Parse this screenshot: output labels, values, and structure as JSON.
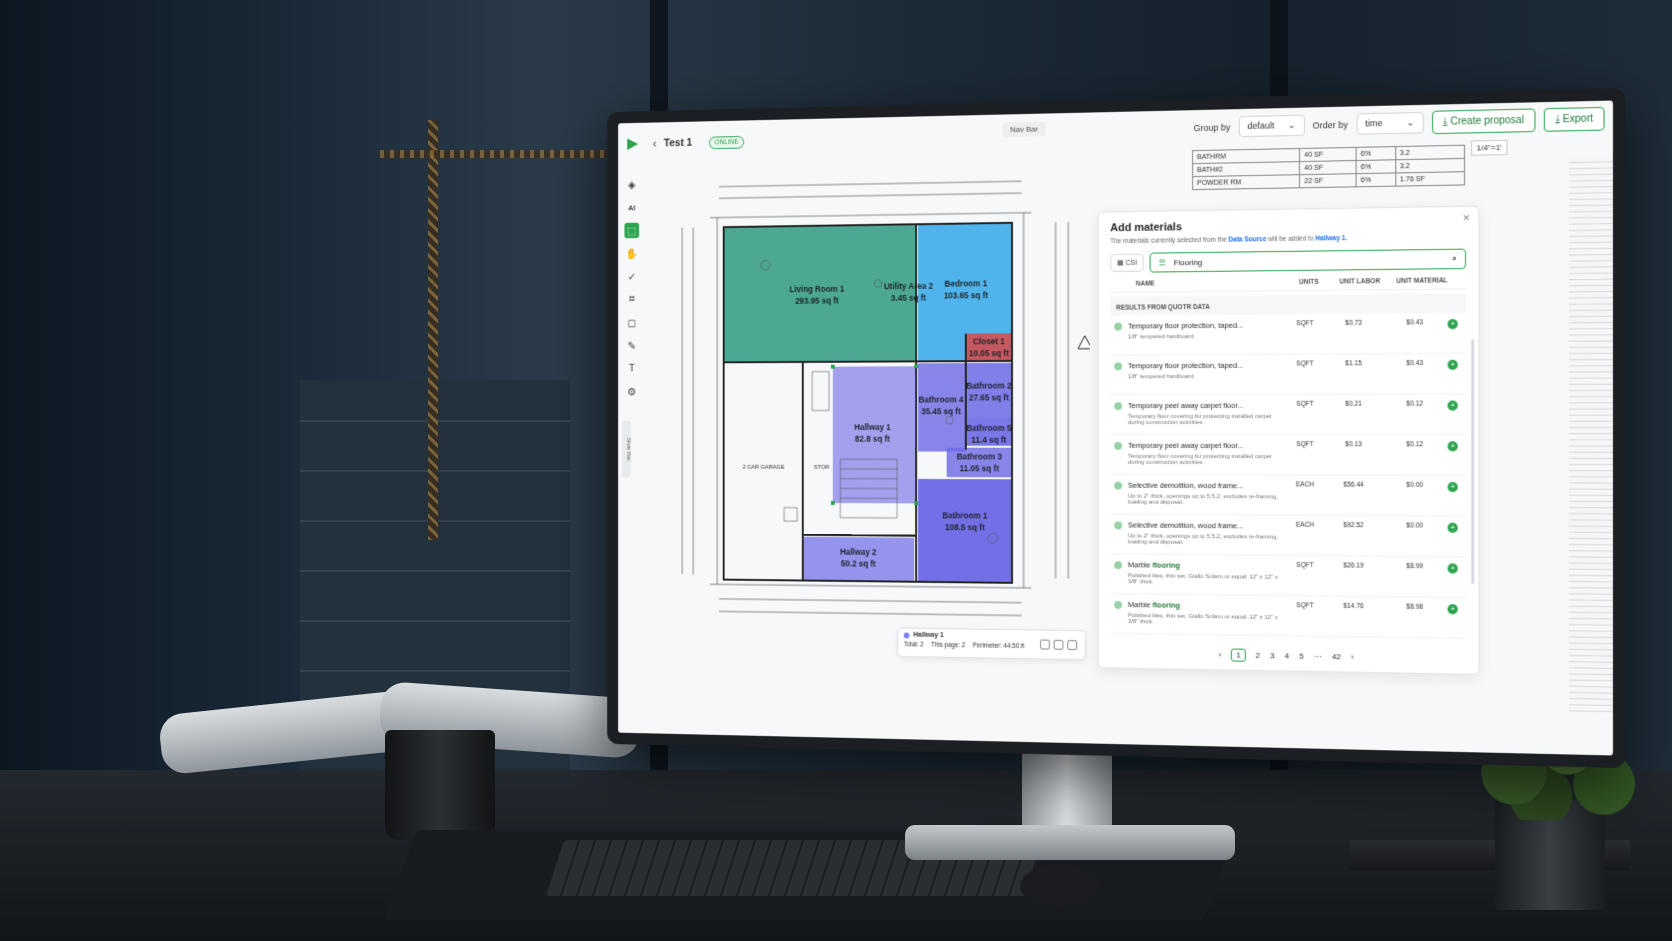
{
  "app": {
    "project_title": "Test 1",
    "status_badge": "ONLINE",
    "nav_bar_label": "Nav Bar"
  },
  "toolbar": {
    "group_by_label": "Group by",
    "group_by_value": "default",
    "order_by_label": "Order by",
    "order_by_value": "time",
    "create_proposal_label": "Create proposal",
    "export_label": "Export",
    "scale_value": "1/4\"=1'"
  },
  "tools": [
    {
      "icon": "layers-icon",
      "glyph": "◈"
    },
    {
      "icon": "ai-icon",
      "glyph": "AI"
    },
    {
      "icon": "select-icon",
      "glyph": "⬚"
    },
    {
      "icon": "hand-icon",
      "glyph": "✋"
    },
    {
      "icon": "check-icon",
      "glyph": "✓"
    },
    {
      "icon": "crop-icon",
      "glyph": "⌗"
    },
    {
      "icon": "shape-icon",
      "glyph": "◻"
    },
    {
      "icon": "edit-icon",
      "glyph": "✎"
    },
    {
      "icon": "text-icon",
      "glyph": "T"
    },
    {
      "icon": "settings-icon",
      "glyph": "⚙"
    }
  ],
  "sidebar_tab_label": "Slide Bar",
  "floor_plan": {
    "rooms": [
      {
        "name": "Living Room 1",
        "area": "293.95 sq ft"
      },
      {
        "name": "Utility Area 2",
        "area": "3.45 sq ft"
      },
      {
        "name": "Bedroom 1",
        "area": "103.65 sq ft"
      },
      {
        "name": "Closet 1",
        "area": "10.05 sq ft"
      },
      {
        "name": "Bathroom 2",
        "area": "27.65 sq ft"
      },
      {
        "name": "Bathroom 4",
        "area": "35.45 sq ft"
      },
      {
        "name": "Bathroom 5",
        "area": "11.4 sq ft"
      },
      {
        "name": "Bathroom 3",
        "area": "11.05 sq ft"
      },
      {
        "name": "Hallway 1",
        "area": "82.8 sq ft"
      },
      {
        "name": "Bathroom 1",
        "area": "108.5 sq ft"
      },
      {
        "name": "Hallway 2",
        "area": "50.2 sq ft"
      }
    ],
    "other_labels": [
      "2 CAR GARAGE",
      "STOR"
    ],
    "colors": {
      "green": "#2e9a80",
      "blue": "#33a8ea",
      "purple": "#6b68e6",
      "red": "#d94848"
    }
  },
  "info_card": {
    "name": "Hallway 1",
    "total": "Total: 2",
    "this_page": "This page: 2",
    "perimeter": "Perimeter: 44.50 ft"
  },
  "finish_table": {
    "rows": [
      [
        "BATHRM",
        "40 SF",
        "6%",
        "3.2"
      ],
      [
        "BATH#2",
        "40 SF",
        "6%",
        "3.2"
      ],
      [
        "POWDER RM",
        "22 SF",
        "6%",
        "1.76 SF"
      ]
    ]
  },
  "panel": {
    "title": "Add materials",
    "description_prefix": "The materials currently selected from the",
    "description_source": "Data Source",
    "description_middle": "will be added to",
    "description_target": "Hallway 1.",
    "csi_label": "CSI",
    "search_value": "Flooring",
    "columns": [
      "NAME",
      "UNITS",
      "UNIT LABOR",
      "UNIT MATERIAL"
    ],
    "results_label": "RESULTS FROM QUOTR DATA",
    "items": [
      {
        "name": "Temporary floor protection, taped...",
        "name_hl": "",
        "desc": "1/8\" tempered hardboard.",
        "unit": "SQFT",
        "labor": "$0.73",
        "material": "$0.43"
      },
      {
        "name": "Temporary floor protection, taped...",
        "name_hl": "",
        "desc": "1/8\" tempered hardboard.",
        "unit": "SQFT",
        "labor": "$1.15",
        "material": "$0.43"
      },
      {
        "name": "Temporary peel away carpet floor...",
        "name_hl": "",
        "desc": "Temporary floor covering for protecting installed carpet during construction activities.",
        "unit": "SQFT",
        "labor": "$0.21",
        "material": "$0.12"
      },
      {
        "name": "Temporary peel away carpet floor...",
        "name_hl": "",
        "desc": "Temporary floor covering for protecting installed carpet during construction activities.",
        "unit": "SQFT",
        "labor": "$0.13",
        "material": "$0.12"
      },
      {
        "name": "Selective demolition, wood frame...",
        "name_hl": "",
        "desc": "Up to 2\" thick, openings up to 5.5.2; excludes re-framing, loading and disposal.",
        "unit": "EACH",
        "labor": "$56.44",
        "material": "$0.00"
      },
      {
        "name": "Selective demolition, wood frame...",
        "name_hl": "",
        "desc": "Up to 2\" thick, openings up to 5.5.2; excludes re-framing, loading and disposal.",
        "unit": "EACH",
        "labor": "$92.52",
        "material": "$0.00"
      },
      {
        "name": "Marble ",
        "name_hl": "flooring",
        "desc": "Polished tiles, thin set, Giallo Solaro or equal: 12\" x 12\" x 3/8\" thick.",
        "unit": "SQFT",
        "labor": "$26.19",
        "material": "$8.99"
      },
      {
        "name": "Marble ",
        "name_hl": "flooring",
        "desc": "Polished tiles, thin set, Giallo Solaro or equal: 12\" x 12\" x 3/8\" thick.",
        "unit": "SQFT",
        "labor": "$14.76",
        "material": "$8.98"
      }
    ],
    "pagination": {
      "prev": "‹",
      "pages": [
        "1",
        "2",
        "3",
        "4",
        "5"
      ],
      "ellipsis": "···",
      "last": "42",
      "next": "›"
    }
  }
}
